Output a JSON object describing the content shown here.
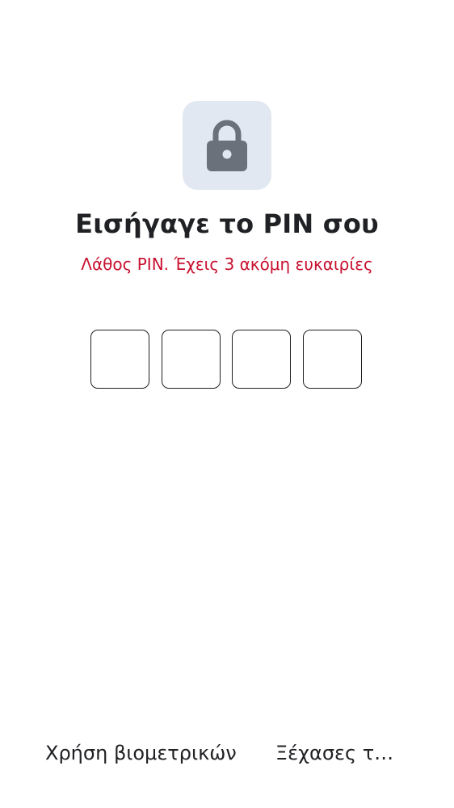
{
  "screen": {
    "icon": "lock-icon",
    "title": "Εισήγαγε το PIN σου",
    "error_message": "Λάθος PIN. Έχεις 3 ακόμη ευκαιρίες",
    "pin_length": 4,
    "pin_digits": [
      "",
      "",
      "",
      ""
    ]
  },
  "footer": {
    "biometrics_label": "Χρήση βιομετρικών",
    "forgot_label": "Ξέχασες το PIN σου;"
  },
  "colors": {
    "error": "#c8102e",
    "icon_badge_bg": "#e2e8f1",
    "icon_fg": "#6b717a",
    "text": "#202124"
  }
}
